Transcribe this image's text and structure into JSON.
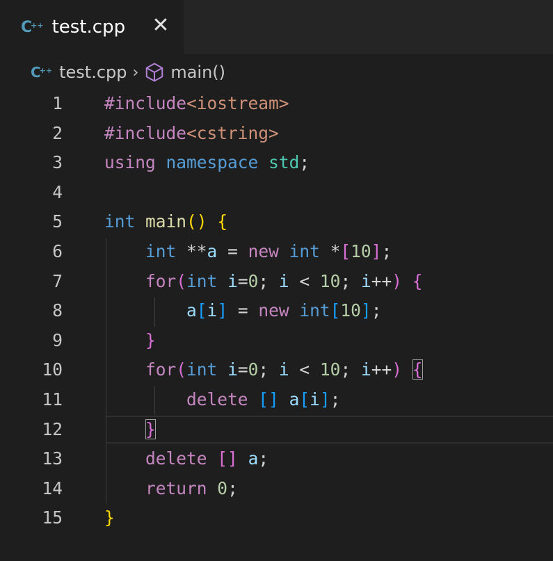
{
  "tab": {
    "icon": "cpp-file-icon",
    "label": "test.cpp",
    "close_icon": "close-icon"
  },
  "breadcrumb": {
    "file": "test.cpp",
    "separator": "›",
    "symbol": "main()",
    "symbol_icon": "cube-icon"
  },
  "editor": {
    "active_line": 12,
    "lines": [
      {
        "number": "1",
        "tokens": [
          [
            "#include",
            "t-inc"
          ],
          [
            "<iostream>",
            "t-str"
          ]
        ]
      },
      {
        "number": "2",
        "tokens": [
          [
            "#include",
            "t-inc"
          ],
          [
            "<cstring>",
            "t-str"
          ]
        ]
      },
      {
        "number": "3",
        "tokens": [
          [
            "using",
            "t-ctrl"
          ],
          [
            " ",
            "t-pun"
          ],
          [
            "namespace",
            "t-kw"
          ],
          [
            " ",
            "t-pun"
          ],
          [
            "std",
            "t-ns"
          ],
          [
            ";",
            "t-pun"
          ]
        ]
      },
      {
        "number": "4",
        "tokens": []
      },
      {
        "number": "5",
        "tokens": [
          [
            "int",
            "t-kw"
          ],
          [
            " ",
            "t-pun"
          ],
          [
            "main",
            "t-fn"
          ],
          [
            "()",
            "t-brk1"
          ],
          [
            " ",
            "t-pun"
          ],
          [
            "{",
            "t-brk1"
          ]
        ]
      },
      {
        "number": "6",
        "tokens": [
          [
            "    ",
            "t-pun"
          ],
          [
            "int",
            "t-kw"
          ],
          [
            " **",
            "t-pun"
          ],
          [
            "a",
            "t-var"
          ],
          [
            " = ",
            "t-pun"
          ],
          [
            "new",
            "t-ctrl"
          ],
          [
            " ",
            "t-pun"
          ],
          [
            "int",
            "t-kw"
          ],
          [
            " *",
            "t-pun"
          ],
          [
            "[",
            "t-brk2"
          ],
          [
            "10",
            "t-num"
          ],
          [
            "]",
            "t-brk2"
          ],
          [
            ";",
            "t-pun"
          ]
        ]
      },
      {
        "number": "7",
        "tokens": [
          [
            "    ",
            "t-pun"
          ],
          [
            "for",
            "t-ctrl"
          ],
          [
            "(",
            "t-brk2"
          ],
          [
            "int",
            "t-kw"
          ],
          [
            " ",
            "t-pun"
          ],
          [
            "i",
            "t-var"
          ],
          [
            "=",
            "t-pun"
          ],
          [
            "0",
            "t-num"
          ],
          [
            "; ",
            "t-pun"
          ],
          [
            "i",
            "t-var"
          ],
          [
            " < ",
            "t-pun"
          ],
          [
            "10",
            "t-num"
          ],
          [
            "; ",
            "t-pun"
          ],
          [
            "i",
            "t-var"
          ],
          [
            "++",
            "t-pun"
          ],
          [
            ")",
            "t-brk2"
          ],
          [
            " ",
            "t-pun"
          ],
          [
            "{",
            "t-brk2"
          ]
        ]
      },
      {
        "number": "8",
        "tokens": [
          [
            "        ",
            "t-pun"
          ],
          [
            "a",
            "t-var"
          ],
          [
            "[",
            "t-brk3"
          ],
          [
            "i",
            "t-var"
          ],
          [
            "]",
            "t-brk3"
          ],
          [
            " = ",
            "t-pun"
          ],
          [
            "new",
            "t-ctrl"
          ],
          [
            " ",
            "t-pun"
          ],
          [
            "int",
            "t-kw"
          ],
          [
            "[",
            "t-brk3"
          ],
          [
            "10",
            "t-num"
          ],
          [
            "]",
            "t-brk3"
          ],
          [
            ";",
            "t-pun"
          ]
        ]
      },
      {
        "number": "9",
        "tokens": [
          [
            "    ",
            "t-pun"
          ],
          [
            "}",
            "t-brk2"
          ]
        ]
      },
      {
        "number": "10",
        "tokens": [
          [
            "    ",
            "t-pun"
          ],
          [
            "for",
            "t-ctrl"
          ],
          [
            "(",
            "t-brk2"
          ],
          [
            "int",
            "t-kw"
          ],
          [
            " ",
            "t-pun"
          ],
          [
            "i",
            "t-var"
          ],
          [
            "=",
            "t-pun"
          ],
          [
            "0",
            "t-num"
          ],
          [
            "; ",
            "t-pun"
          ],
          [
            "i",
            "t-var"
          ],
          [
            " < ",
            "t-pun"
          ],
          [
            "10",
            "t-num"
          ],
          [
            "; ",
            "t-pun"
          ],
          [
            "i",
            "t-var"
          ],
          [
            "++",
            "t-pun"
          ],
          [
            ")",
            "t-brk2"
          ],
          [
            " ",
            "t-pun"
          ],
          [
            "{",
            "t-brk2 bracket-match"
          ]
        ]
      },
      {
        "number": "11",
        "tokens": [
          [
            "        ",
            "t-pun"
          ],
          [
            "delete",
            "t-ctrl"
          ],
          [
            " ",
            "t-pun"
          ],
          [
            "[]",
            "t-brk3"
          ],
          [
            " ",
            "t-pun"
          ],
          [
            "a",
            "t-var"
          ],
          [
            "[",
            "t-brk3"
          ],
          [
            "i",
            "t-var"
          ],
          [
            "]",
            "t-brk3"
          ],
          [
            ";",
            "t-pun"
          ]
        ]
      },
      {
        "number": "12",
        "tokens": [
          [
            "    ",
            "t-pun"
          ],
          [
            "}",
            "t-brk2 bracket-match"
          ]
        ]
      },
      {
        "number": "13",
        "tokens": [
          [
            "    ",
            "t-pun"
          ],
          [
            "delete",
            "t-ctrl"
          ],
          [
            " ",
            "t-pun"
          ],
          [
            "[]",
            "t-brk2"
          ],
          [
            " ",
            "t-pun"
          ],
          [
            "a",
            "t-var"
          ],
          [
            ";",
            "t-pun"
          ]
        ]
      },
      {
        "number": "14",
        "tokens": [
          [
            "    ",
            "t-pun"
          ],
          [
            "return",
            "t-ctrl"
          ],
          [
            " ",
            "t-pun"
          ],
          [
            "0",
            "t-num"
          ],
          [
            ";",
            "t-pun"
          ]
        ]
      },
      {
        "number": "15",
        "tokens": [
          [
            "}",
            "t-brk1"
          ]
        ]
      }
    ]
  }
}
